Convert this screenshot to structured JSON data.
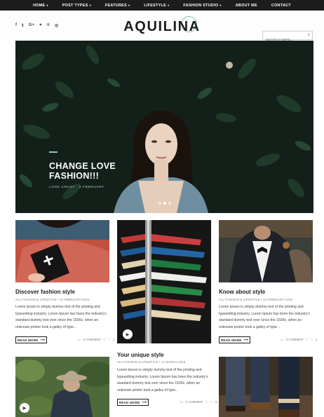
{
  "nav": {
    "items": [
      {
        "label": "HOME",
        "caret": "▾"
      },
      {
        "label": "POST TYPES",
        "caret": "▾"
      },
      {
        "label": "FEATURES",
        "caret": "▾"
      },
      {
        "label": "LIFESTYLE",
        "caret": "▾"
      },
      {
        "label": "FASHION STUDIO",
        "caret": "▾"
      },
      {
        "label": "ABOUT ME",
        "caret": ""
      },
      {
        "label": "CONTACT",
        "caret": ""
      }
    ]
  },
  "header": {
    "logo": "AQUILINA",
    "social_icons": [
      "facebook-icon",
      "twitter-icon",
      "google-plus-icon",
      "heart-icon",
      "pinterest-icon",
      "instagram-icon"
    ],
    "social_glyphs": [
      "f",
      "𝕥",
      "G+",
      "♥",
      "℗",
      "◎"
    ],
    "search_placeholder": "SEARCH HERE...",
    "search_icon": "search-icon"
  },
  "hero": {
    "title": "CHANGE LOVE FASHION!!!",
    "meta": "LOOK CRAZY · 2 FEBRUARY",
    "slides": 3,
    "active_slide": 2,
    "accent_color": "#7ecfb6"
  },
  "posts": [
    {
      "title": "Discover fashion style",
      "meta": "ALL FASHION & LIFESTYLE • 12 FEBRUARY 2016",
      "excerpt": "Lorem Ipsum is simply dummy text of the printing and typesetting industry. Lorem Ipsum has been the industry's standard dummy text ever since the 1500s, when an unknown printer took a galley of type...",
      "read_more": "READ MORE",
      "comments": "0 COMMENT",
      "likes": "1"
    },
    {
      "title": "Your unique style",
      "meta": "ALL FASHION & LIFESTYLE • 17 MARCH 2016",
      "excerpt": "Lorem Ipsum is simply dummy text of the printing and typesetting industry. Lorem Ipsum has been the industry's standard dummy text ever since the 1500s, when an unknown printer took a galley of type...",
      "read_more": "READ MORE",
      "comments": "0 COMMENT",
      "likes": "0"
    },
    {
      "title": "Know about style",
      "meta": "ALL FASHION & LIFESTYLE • 12 FEBRUARY 2016",
      "excerpt": "Lorem Ipsum is simply dummy text of the printing and typesetting industry. Lorem Ipsum has been the industry's standard dummy text ever since the 1500s, when an unknown printer took a galley of type...",
      "read_more": "READ MORE",
      "comments": "0 COMMENT",
      "likes": "1"
    }
  ],
  "icons": {
    "arrow": "⟶",
    "comment": "💬",
    "heart": "♡",
    "video": "▶"
  }
}
